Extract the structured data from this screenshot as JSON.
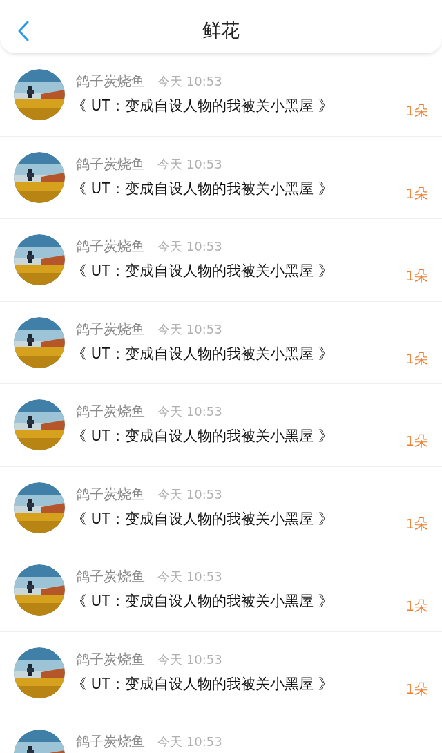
{
  "header": {
    "title": "鲜花"
  },
  "rows": [
    {
      "name": "鸽子炭烧鱼",
      "time": "今天 10:53",
      "title": "《 UT：变成自设人物的我被关小黑屋 》",
      "amount": "1朵"
    },
    {
      "name": "鸽子炭烧鱼",
      "time": "今天 10:53",
      "title": "《 UT：变成自设人物的我被关小黑屋 》",
      "amount": "1朵"
    },
    {
      "name": "鸽子炭烧鱼",
      "time": "今天 10:53",
      "title": "《 UT：变成自设人物的我被关小黑屋 》",
      "amount": "1朵"
    },
    {
      "name": "鸽子炭烧鱼",
      "time": "今天 10:53",
      "title": "《 UT：变成自设人物的我被关小黑屋 》",
      "amount": "1朵"
    },
    {
      "name": "鸽子炭烧鱼",
      "time": "今天 10:53",
      "title": "《 UT：变成自设人物的我被关小黑屋 》",
      "amount": "1朵"
    },
    {
      "name": "鸽子炭烧鱼",
      "time": "今天 10:53",
      "title": "《 UT：变成自设人物的我被关小黑屋 》",
      "amount": "1朵"
    },
    {
      "name": "鸽子炭烧鱼",
      "time": "今天 10:53",
      "title": "《 UT：变成自设人物的我被关小黑屋 》",
      "amount": "1朵"
    },
    {
      "name": "鸽子炭烧鱼",
      "time": "今天 10:53",
      "title": "《 UT：变成自设人物的我被关小黑屋 》",
      "amount": "1朵"
    },
    {
      "name": "鸽子炭烧鱼",
      "time": "今天 10:53"
    }
  ]
}
